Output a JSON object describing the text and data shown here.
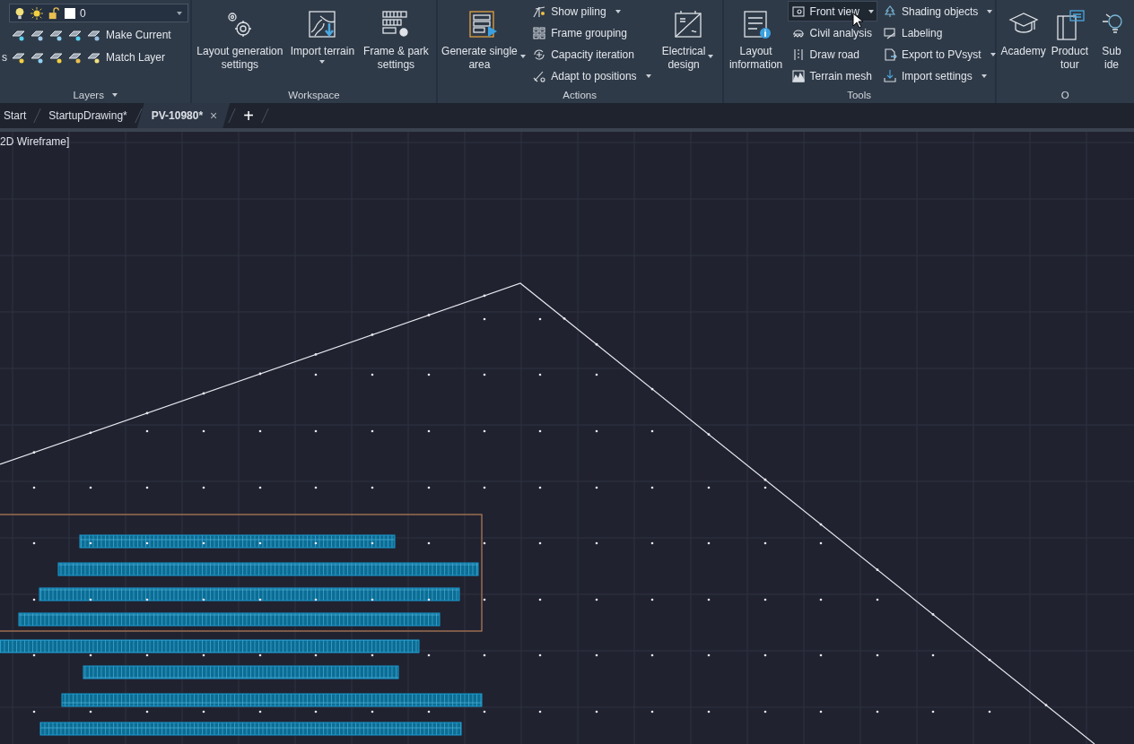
{
  "ribbon": {
    "layers": {
      "fragment": "s",
      "layer_combo": {
        "value": "0"
      },
      "buttons": [
        {
          "label": "Make Current"
        },
        {
          "label": "Match Layer"
        }
      ],
      "title": "Layers"
    },
    "workspace": {
      "title": "Workspace",
      "buttons": [
        {
          "label_lines": [
            "Layout generation",
            "settings"
          ],
          "dropdown": false
        },
        {
          "label_lines": [
            "Import terrain"
          ],
          "dropdown": true
        },
        {
          "label_lines": [
            "Frame & park",
            "settings"
          ],
          "dropdown": false
        }
      ]
    },
    "actions": {
      "title": "Actions",
      "large": [
        {
          "label_lines": [
            "Generate single",
            "area"
          ],
          "dropdown": true
        }
      ],
      "small": [
        {
          "label": "Show piling",
          "dropdown": true
        },
        {
          "label": "Frame grouping",
          "dropdown": false
        },
        {
          "label": "Capacity iteration",
          "dropdown": false
        },
        {
          "label": "Adapt to positions",
          "dropdown": true
        }
      ],
      "large_after": [
        {
          "label_lines": [
            "Electrical",
            "design"
          ],
          "dropdown": true
        }
      ]
    },
    "tools": {
      "title": "Tools",
      "large": [
        {
          "label_lines": [
            "Layout",
            "information"
          ],
          "dropdown": false
        }
      ],
      "columns": [
        [
          {
            "label": "Front view",
            "dropdown": true,
            "hovered": true
          },
          {
            "label": "Civil analysis",
            "dropdown": false,
            "hovered": false
          },
          {
            "label": "Draw road",
            "dropdown": false,
            "hovered": false
          },
          {
            "label": "Terrain mesh",
            "dropdown": false,
            "hovered": false
          }
        ],
        [
          {
            "label": "Shading objects",
            "dropdown": true,
            "hovered": false
          },
          {
            "label": "Labeling",
            "dropdown": false,
            "hovered": false
          },
          {
            "label": "Export to PVsyst",
            "dropdown": true,
            "hovered": false
          },
          {
            "label": "Import settings",
            "dropdown": true,
            "hovered": false
          }
        ]
      ]
    },
    "other": {
      "title": "O",
      "buttons": [
        {
          "label_lines": [
            "Academy"
          ]
        },
        {
          "label_lines": [
            "Product",
            "tour"
          ]
        },
        {
          "label_lines": [
            "Sub",
            "ide"
          ]
        }
      ]
    }
  },
  "tabs": [
    {
      "label": "Start",
      "selected": false
    },
    {
      "label": "StartupDrawing*",
      "selected": false
    },
    {
      "label": "PV-10980*",
      "selected": true,
      "close": "×"
    }
  ],
  "new_tab": "+",
  "viewport": {
    "label": "2D Wireframe]"
  }
}
